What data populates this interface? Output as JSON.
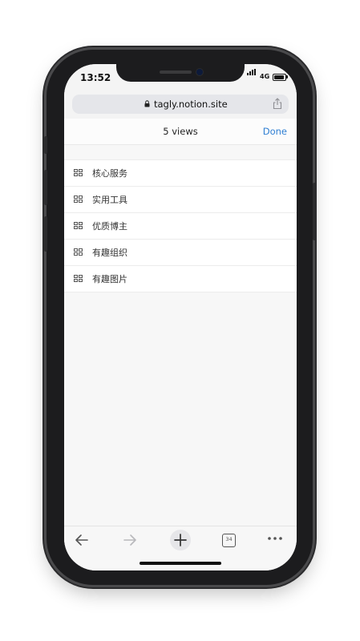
{
  "status_bar": {
    "time": "13:52",
    "network": "4G"
  },
  "browser": {
    "url": "tagly.notion.site"
  },
  "header": {
    "title": "5 views",
    "done_label": "Done"
  },
  "views": [
    {
      "label": "核心服务"
    },
    {
      "label": "实用工具"
    },
    {
      "label": "优质博主"
    },
    {
      "label": "有趣组织"
    },
    {
      "label": "有趣图片"
    }
  ],
  "toolbar": {
    "tab_count": "34"
  },
  "icons": {
    "lock": "lock-icon",
    "share": "share-icon",
    "view": "gallery-view-icon",
    "back": "back-arrow-icon",
    "forward": "forward-arrow-icon",
    "new_tab": "plus-icon",
    "tabs": "tabs-icon",
    "more": "more-icon"
  },
  "colors": {
    "accent": "#2f7fd3",
    "url_bar": "#e5e6ea",
    "frame": "#1c1c1e"
  }
}
